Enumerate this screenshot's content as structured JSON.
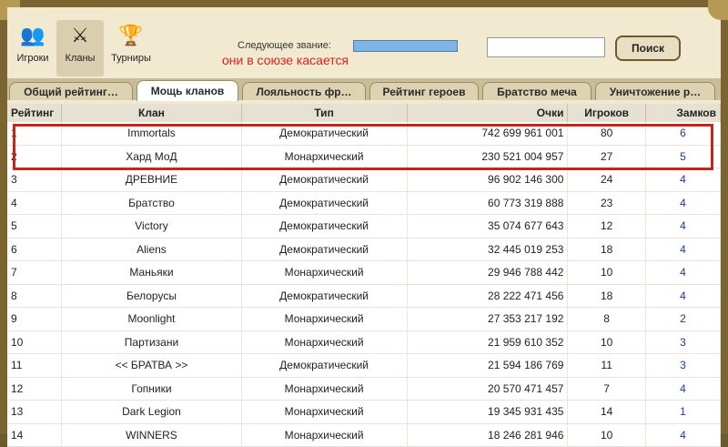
{
  "nav": [
    {
      "label": "Игроки",
      "icon": "players-icon",
      "glyph": "👥"
    },
    {
      "label": "Кланы",
      "icon": "clans-icon",
      "glyph": "⚔"
    },
    {
      "label": "Турниры",
      "icon": "tournaments-icon",
      "glyph": "🏆"
    }
  ],
  "header": {
    "rank_label": "Следующее звание:",
    "annotation": "они в союзе касается",
    "search_placeholder": "",
    "search_button": "Поиск"
  },
  "tabs": [
    "Общий рейтинг…",
    "Мощь кланов",
    "Лояльность фр…",
    "Рейтинг героев",
    "Братство меча",
    "Уничтожение р…"
  ],
  "active_tab": 1,
  "table": {
    "headers": [
      "Рейтинг",
      "Клан",
      "Тип",
      "Очки",
      "Игроков",
      "Замков"
    ],
    "rows": [
      [
        "1",
        "Immortals",
        "Демократический",
        "742 699 961 001",
        "80",
        "6"
      ],
      [
        "2",
        "Хард МоД",
        "Монархический",
        "230 521 004 957",
        "27",
        "5"
      ],
      [
        "3",
        "ДРЕВНИЕ",
        "Демократический",
        "96 902 146 300",
        "24",
        "4"
      ],
      [
        "4",
        "Братство",
        "Демократический",
        "60 773 319 888",
        "23",
        "4"
      ],
      [
        "5",
        "Victory",
        "Демократический",
        "35 074 677 643",
        "12",
        "4"
      ],
      [
        "6",
        "Aliens",
        "Демократический",
        "32 445 019 253",
        "18",
        "4"
      ],
      [
        "7",
        "Маньяки",
        "Монархический",
        "29 946 788 442",
        "10",
        "4"
      ],
      [
        "8",
        "Белорусы",
        "Демократический",
        "28 222 471 456",
        "18",
        "4"
      ],
      [
        "9",
        "Moonlight",
        "Монархический",
        "27 353 217 192",
        "8",
        "2"
      ],
      [
        "10",
        "Партизани",
        "Монархический",
        "21 959 610 352",
        "10",
        "3"
      ],
      [
        "11",
        "<< БРАТВА >>",
        "Демократический",
        "21 594 186 769",
        "11",
        "3"
      ],
      [
        "12",
        "Гопники",
        "Монархический",
        "20 570 471 457",
        "7",
        "4"
      ],
      [
        "13",
        "Dark Legion",
        "Монархический",
        "19 345 931 435",
        "14",
        "1"
      ],
      [
        "14",
        "WINNERS",
        "Монархический",
        "18 246 281 946",
        "10",
        "4"
      ]
    ]
  },
  "colors": {
    "highlight": "#c8251a",
    "annotation": "#e0201a",
    "castles": "#1a3c8a"
  }
}
